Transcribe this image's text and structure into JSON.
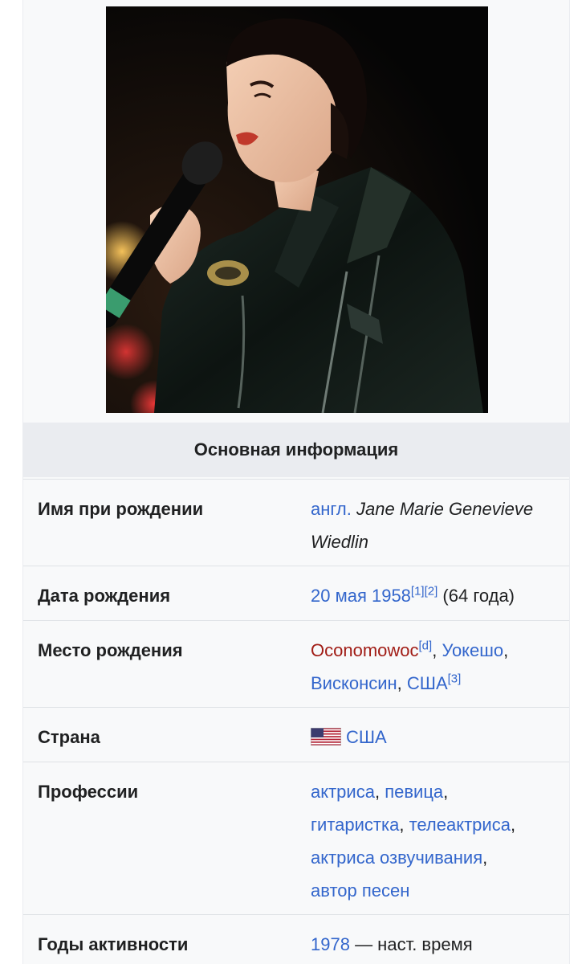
{
  "photo": {
    "alt": "photo"
  },
  "section_title": "Основная информация",
  "rows": {
    "birth_name": {
      "label": "Имя при рождении",
      "lang_link": "англ.",
      "name_line1": "Jane Marie Genevieve",
      "name_line2": "Wiedlin"
    },
    "birth_date": {
      "label": "Дата рождения",
      "date_link": "20 мая 1958",
      "ref1": "[1]",
      "ref2": "[2]",
      "age": " (64 года)"
    },
    "birth_place": {
      "label": "Место рождения",
      "town": "Oconomowoc",
      "town_ref": "[d]",
      "sep1": ", ",
      "county": "Уокешо",
      "sep2": ",",
      "state": "Висконсин",
      "sep3": ", ",
      "country": "США",
      "ref3": "[3]"
    },
    "country": {
      "label": "Страна",
      "flag_icon": "us-flag-icon",
      "value": "США"
    },
    "professions": {
      "label": "Профессии",
      "items": [
        "актриса",
        "певица",
        "гитаристка",
        "телеактриса",
        "актриса озвучивания",
        "автор песен"
      ],
      "sep": ","
    },
    "years_active": {
      "label": "Годы активности",
      "start": "1978",
      "rest": " — наст. время"
    }
  },
  "colors": {
    "link": "#3366cc",
    "redlink": "#a11d16",
    "header_bg": "#eaecf0",
    "box_bg": "#f8f9fa"
  }
}
